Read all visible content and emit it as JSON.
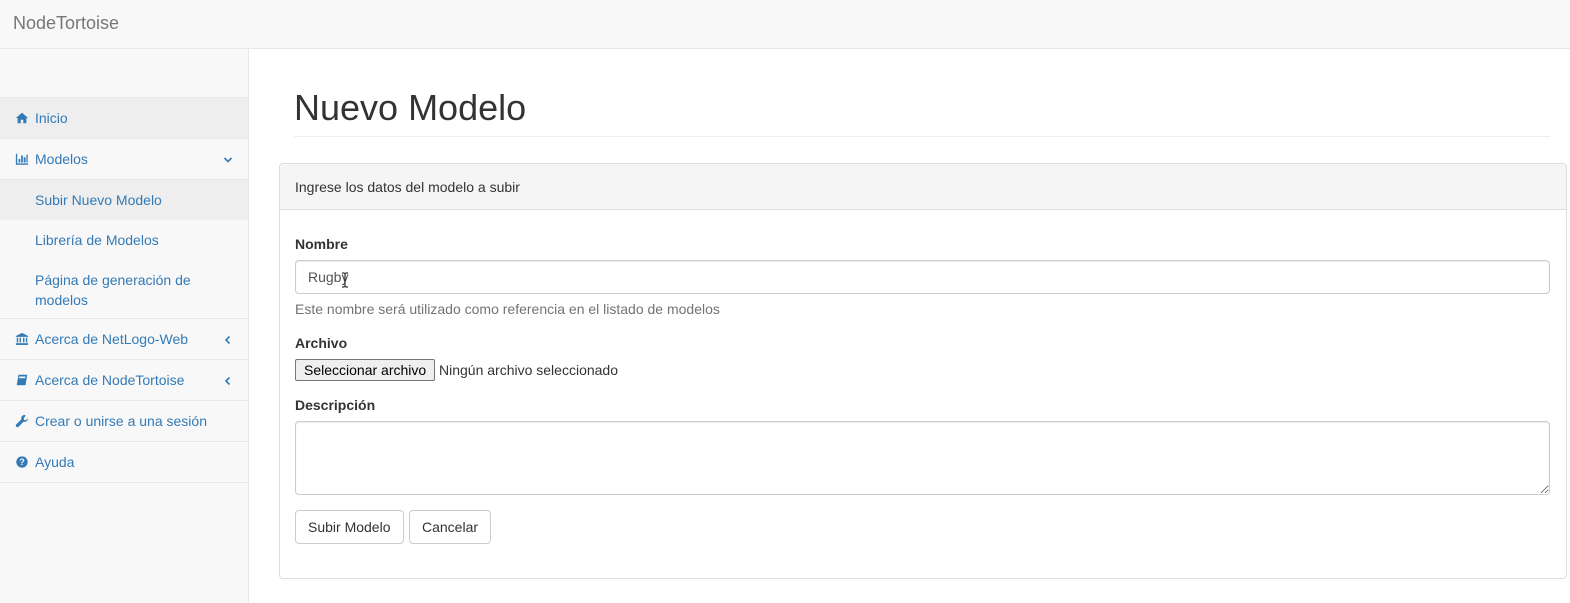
{
  "app": {
    "brand": "NodeTortoise"
  },
  "sidebar": {
    "items": [
      {
        "label": "Inicio",
        "icon": "home-icon"
      },
      {
        "label": "Modelos",
        "icon": "bar-chart-icon",
        "arrow": "chevron-down-icon",
        "children": [
          {
            "label": "Subir Nuevo Modelo",
            "active": true
          },
          {
            "label": "Librería de Modelos"
          },
          {
            "label": "Página de generación de modelos"
          }
        ]
      },
      {
        "label": "Acerca de NetLogo-Web",
        "icon": "bank-icon",
        "arrow": "chevron-left-icon"
      },
      {
        "label": "Acerca de NodeTortoise",
        "icon": "book-icon",
        "arrow": "chevron-left-icon"
      },
      {
        "label": "Crear o unirse a una sesión",
        "icon": "wrench-icon"
      },
      {
        "label": "Ayuda",
        "icon": "question-circle-icon"
      }
    ]
  },
  "page": {
    "title": "Nuevo Modelo",
    "panel_heading": "Ingrese los datos del modelo a subir"
  },
  "form": {
    "name_label": "Nombre",
    "name_value": "Rugby",
    "name_help": "Este nombre será utilizado como referencia en el listado de modelos",
    "file_label": "Archivo",
    "file_button": "Seleccionar archivo",
    "file_status": "Ningún archivo seleccionado",
    "description_label": "Descripción",
    "description_value": "",
    "submit_label": "Subir Modelo",
    "cancel_label": "Cancelar"
  },
  "colors": {
    "link": "#337ab7",
    "sidebar_bg": "#f8f8f8",
    "active_bg": "#eeeeee"
  }
}
